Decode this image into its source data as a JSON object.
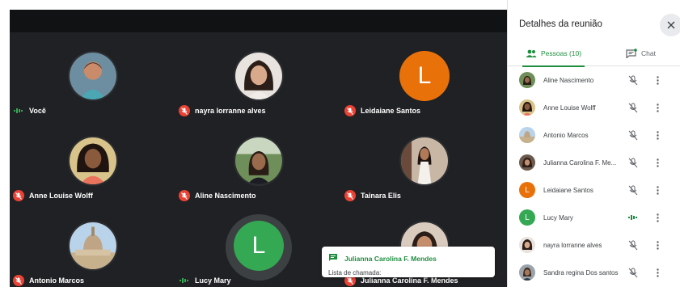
{
  "colors": {
    "stage_bg": "#202124",
    "mic_off": "#ea4335",
    "accent_green": "#1e8e3e",
    "avatar_orange": "#e8710a",
    "avatar_green": "#34a853"
  },
  "tiles": [
    {
      "name": "Você",
      "mic": "on",
      "avatar": "photo"
    },
    {
      "name": "nayra lorranne alves",
      "mic": "off",
      "avatar": "photo"
    },
    {
      "name": "Leidaiane Santos",
      "mic": "off",
      "avatar": "letter",
      "letter": "L"
    },
    {
      "name": "Anne Louise Wolff",
      "mic": "off",
      "avatar": "photo"
    },
    {
      "name": "Aline Nascimento",
      "mic": "off",
      "avatar": "photo"
    },
    {
      "name": "Tainara Elis",
      "mic": "off",
      "avatar": "photo"
    },
    {
      "name": "Antonio Marcos",
      "mic": "off",
      "avatar": "photo"
    },
    {
      "name": "Lucy Mary",
      "mic": "on",
      "avatar": "letter",
      "letter": "L"
    },
    {
      "name": "Julianna Carolina F. Mendes",
      "mic": "off",
      "avatar": "photo"
    }
  ],
  "toast": {
    "sender": "Julianna Carolina F. Mendes",
    "message": "Lista de chamada:",
    "icon": "chat-icon"
  },
  "panel": {
    "title": "Detalhes da reunião",
    "close_icon": "close-icon",
    "tabs": [
      {
        "label": "Pessoas (10)",
        "icon": "people-icon",
        "active": true
      },
      {
        "label": "Chat",
        "icon": "chat-icon",
        "active": false
      }
    ],
    "participants": [
      {
        "name": "Aline Nascimento",
        "mic": "off",
        "avatar": "photo"
      },
      {
        "name": "Anne Louise Wolff",
        "mic": "off",
        "avatar": "photo"
      },
      {
        "name": "Antonio Marcos",
        "mic": "off",
        "avatar": "photo"
      },
      {
        "name": "Julianna Carolina F. Me...",
        "mic": "off",
        "avatar": "photo"
      },
      {
        "name": "Leidaiane Santos",
        "mic": "off",
        "avatar": "letter",
        "letter": "L"
      },
      {
        "name": "Lucy Mary",
        "mic": "on",
        "avatar": "letter",
        "letter": "L"
      },
      {
        "name": "nayra lorranne alves",
        "mic": "off",
        "avatar": "photo"
      },
      {
        "name": "Sandra regina Dos santos",
        "mic": "off",
        "avatar": "photo"
      }
    ]
  }
}
